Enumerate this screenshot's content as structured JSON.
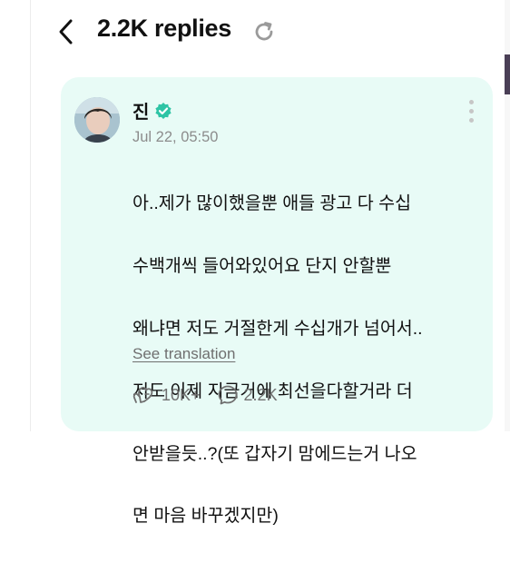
{
  "header": {
    "title": "2.2K replies",
    "back_icon": "chevron-left-icon",
    "refresh_icon": "refresh-icon"
  },
  "post": {
    "author": "진",
    "verified": true,
    "timestamp": "Jul 22, 05:50",
    "lines": [
      "아..제가 많이했을뿐 애들 광고 다 수십",
      "수백개씩 들어와있어요 단지 안할뿐",
      "왜냐면 저도 거절한게 수십개가 넘어서..",
      "저도 이제 지금거에 최선을다할거라 더",
      "안받을듯..?(또 갑자기 맘에드는거 나오",
      "면 마음 바꾸겠지만)"
    ],
    "see_translation": "See translation",
    "likes": "10K+",
    "comments": "2.2K"
  },
  "colors": {
    "card_background": "#e8fbf6",
    "verified_badge": "#2ec4a5",
    "muted_text": "#8c8c8c"
  }
}
